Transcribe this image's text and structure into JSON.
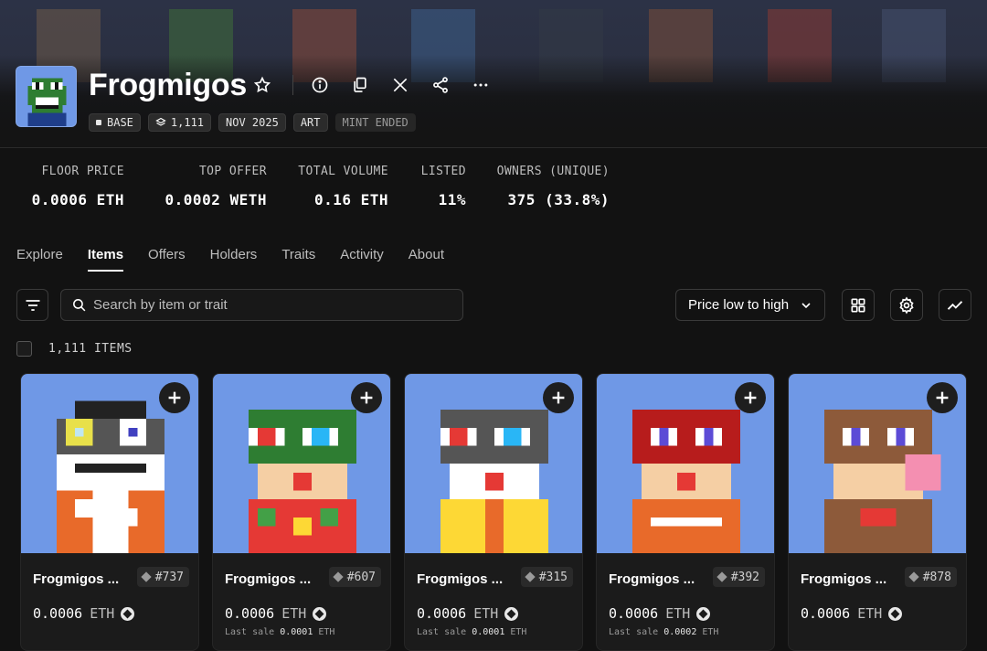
{
  "collection": {
    "name": "Frogmigos",
    "chips": {
      "chain": "BASE",
      "supply": "1,111",
      "date": "NOV 2025",
      "category": "ART",
      "status": "MINT ENDED"
    },
    "title_icons": [
      "star-icon",
      "info-icon",
      "copy-icon",
      "x-logo-icon",
      "share-icon",
      "more-icon"
    ]
  },
  "stats": [
    {
      "label": "FLOOR PRICE",
      "value": "0.0006 ETH"
    },
    {
      "label": "TOP OFFER",
      "value": "0.0002 WETH"
    },
    {
      "label": "TOTAL VOLUME",
      "value": "0.16 ETH"
    },
    {
      "label": "LISTED",
      "value": "11%"
    },
    {
      "label": "OWNERS (UNIQUE)",
      "value": "375 (33.8%)"
    }
  ],
  "tabs": [
    "Explore",
    "Items",
    "Offers",
    "Holders",
    "Traits",
    "Activity",
    "About"
  ],
  "active_tab": "Items",
  "toolbar": {
    "search_placeholder": "Search by item or trait",
    "sort_label": "Price low to high"
  },
  "items_count": "1,111 ITEMS",
  "items": [
    {
      "name": "Frogmigos ...",
      "id": "#737",
      "price": "0.0006",
      "currency": "ETH",
      "last_sale_label": "",
      "last_sale_value": "",
      "last_sale_currency": ""
    },
    {
      "name": "Frogmigos ...",
      "id": "#607",
      "price": "0.0006",
      "currency": "ETH",
      "last_sale_label": "Last sale",
      "last_sale_value": "0.0001",
      "last_sale_currency": "ETH"
    },
    {
      "name": "Frogmigos ...",
      "id": "#315",
      "price": "0.0006",
      "currency": "ETH",
      "last_sale_label": "Last sale",
      "last_sale_value": "0.0001",
      "last_sale_currency": "ETH"
    },
    {
      "name": "Frogmigos ...",
      "id": "#392",
      "price": "0.0006",
      "currency": "ETH",
      "last_sale_label": "Last sale",
      "last_sale_value": "0.0002",
      "last_sale_currency": "ETH"
    },
    {
      "name": "Frogmigos ...",
      "id": "#878",
      "price": "0.0006",
      "currency": "ETH",
      "last_sale_label": "",
      "last_sale_value": "",
      "last_sale_currency": ""
    }
  ],
  "colors": {
    "background": "#121212",
    "card_bg": "#1b1b1b",
    "nft_bg": "#6f98e6",
    "text_muted": "#bdbdbd"
  }
}
